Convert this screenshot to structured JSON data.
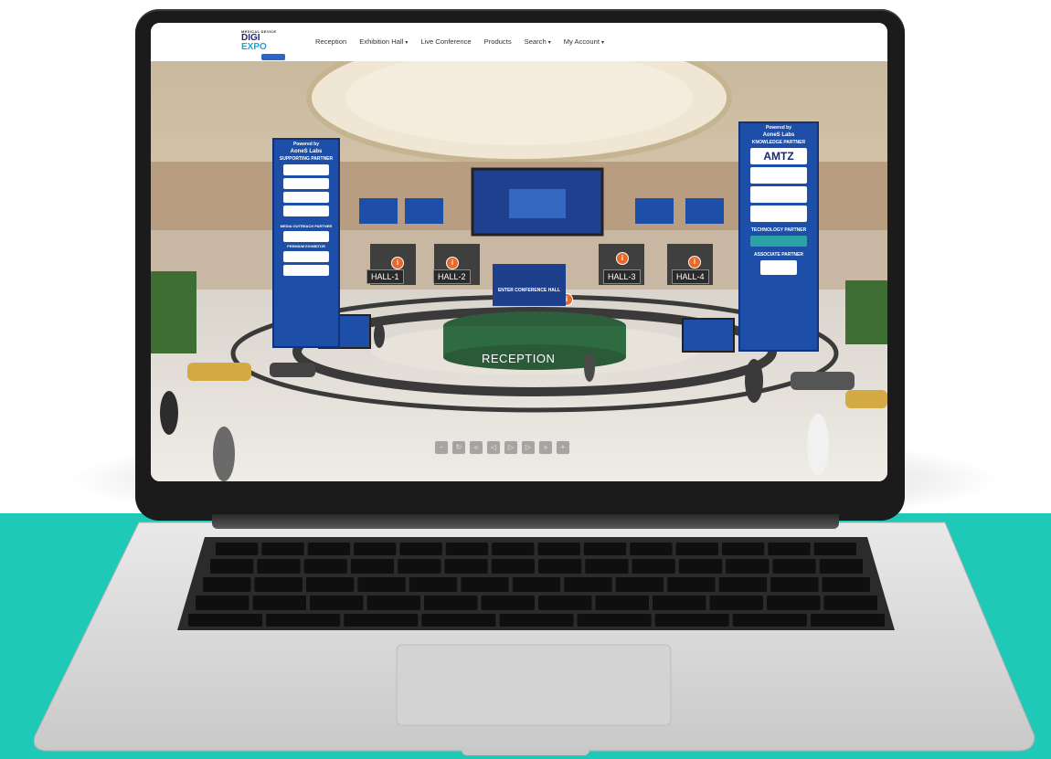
{
  "colors": {
    "background_band": "#1ec9b7",
    "nav_bg": "#ffffff",
    "panel_blue": "#1d4ea8",
    "info_orange": "#e8692a",
    "laptop_bezel": "#1b1b1b",
    "laptop_base": "#d9d9d9"
  },
  "logo": {
    "line1": "MEDICAL DEVICE",
    "line2a": "DIGI",
    "line2b": "EXPO"
  },
  "nav": {
    "items": [
      {
        "label": "Reception",
        "has_dropdown": false
      },
      {
        "label": "Exhibition Hall",
        "has_dropdown": true
      },
      {
        "label": "Live Conference",
        "has_dropdown": false
      },
      {
        "label": "Products",
        "has_dropdown": false
      },
      {
        "label": "Search",
        "has_dropdown": true
      },
      {
        "label": "My Account",
        "has_dropdown": true
      }
    ],
    "caret": "▾"
  },
  "hall": {
    "hall_signs": [
      "HALL-1",
      "HALL-2",
      "HALL-3",
      "HALL-4"
    ],
    "reception_label": "RECEPTION",
    "enter_label": "ENTER CONFERENCE HALL",
    "left_banner": {
      "powered": "Powered by",
      "brand": "AoneS Labs",
      "supporting": "SUPPORTING PARTNER",
      "media": "MEDIA OUTREACH PARTNER",
      "premium": "PREMIUM EXHIBITOR"
    },
    "right_banner": {
      "powered": "Powered by",
      "brand": "AoneS Labs",
      "knowledge": "KNOWLEDGE PARTNER",
      "knowledge_logo": "AMTZ",
      "technology": "TECHNOLOGY PARTNER",
      "associate": "ASSOCIATE PARTNER"
    }
  },
  "controls": [
    {
      "icon": "zoom-out-icon",
      "glyph": "−"
    },
    {
      "icon": "rotate-icon",
      "glyph": "↻"
    },
    {
      "icon": "fast-left-icon",
      "glyph": "«"
    },
    {
      "icon": "left-icon",
      "glyph": "◁"
    },
    {
      "icon": "right-icon",
      "glyph": "▷"
    },
    {
      "icon": "up-icon",
      "glyph": "▷"
    },
    {
      "icon": "fast-right-icon",
      "glyph": "»"
    },
    {
      "icon": "zoom-in-icon",
      "glyph": "+"
    }
  ]
}
